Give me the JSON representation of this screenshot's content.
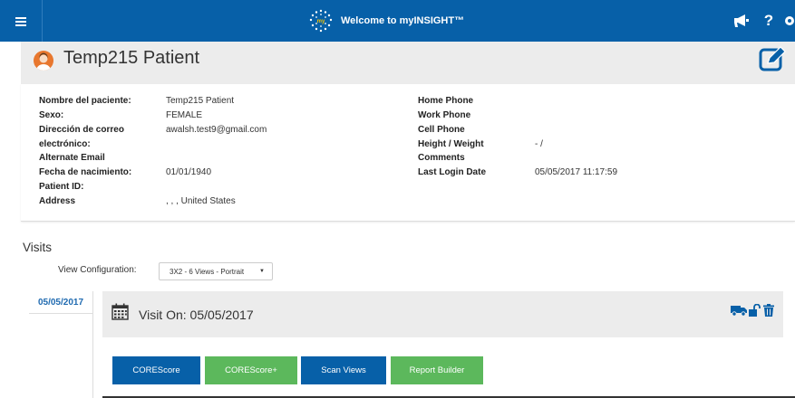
{
  "header": {
    "title": "Welcome to myINSIGHT™",
    "logo_text": "my"
  },
  "patient": {
    "name": "Temp215 Patient"
  },
  "details": {
    "left": [
      {
        "label": "Nombre del paciente:",
        "value": "Temp215 Patient"
      },
      {
        "label": "Sexo:",
        "value": "FEMALE"
      },
      {
        "label": "Dirección de correo",
        "value": "awalsh.test9@gmail.com"
      },
      {
        "label": "electrónico:",
        "value": ""
      },
      {
        "label": "Alternate Email",
        "value": ""
      },
      {
        "label": "Fecha de nacimiento:",
        "value": "01/01/1940"
      },
      {
        "label": "Patient ID:",
        "value": ""
      },
      {
        "label": "Address",
        "value": ", , , United States"
      }
    ],
    "right": [
      {
        "label": "Home Phone",
        "value": ""
      },
      {
        "label": "Work Phone",
        "value": ""
      },
      {
        "label": "Cell Phone",
        "value": ""
      },
      {
        "label": "Height / Weight",
        "value": "- /"
      },
      {
        "label": "Comments",
        "value": ""
      },
      {
        "label": "Last Login Date",
        "value": "05/05/2017 11:17:59"
      }
    ]
  },
  "visits": {
    "title": "Visits",
    "view_config_label": "View Configuration:",
    "view_config_value": "3X2 - 6 Views - Portrait",
    "date_tab": "05/05/2017",
    "visit_title": "Visit On: 05/05/2017",
    "buttons": {
      "corescore": "COREScore",
      "corescore_plus": "COREScore+",
      "scan_views": "Scan Views",
      "report_builder": "Report Builder"
    }
  },
  "colors": {
    "primary": "#0760a8",
    "green": "#5cb85c",
    "avatar": "#e8772e"
  }
}
